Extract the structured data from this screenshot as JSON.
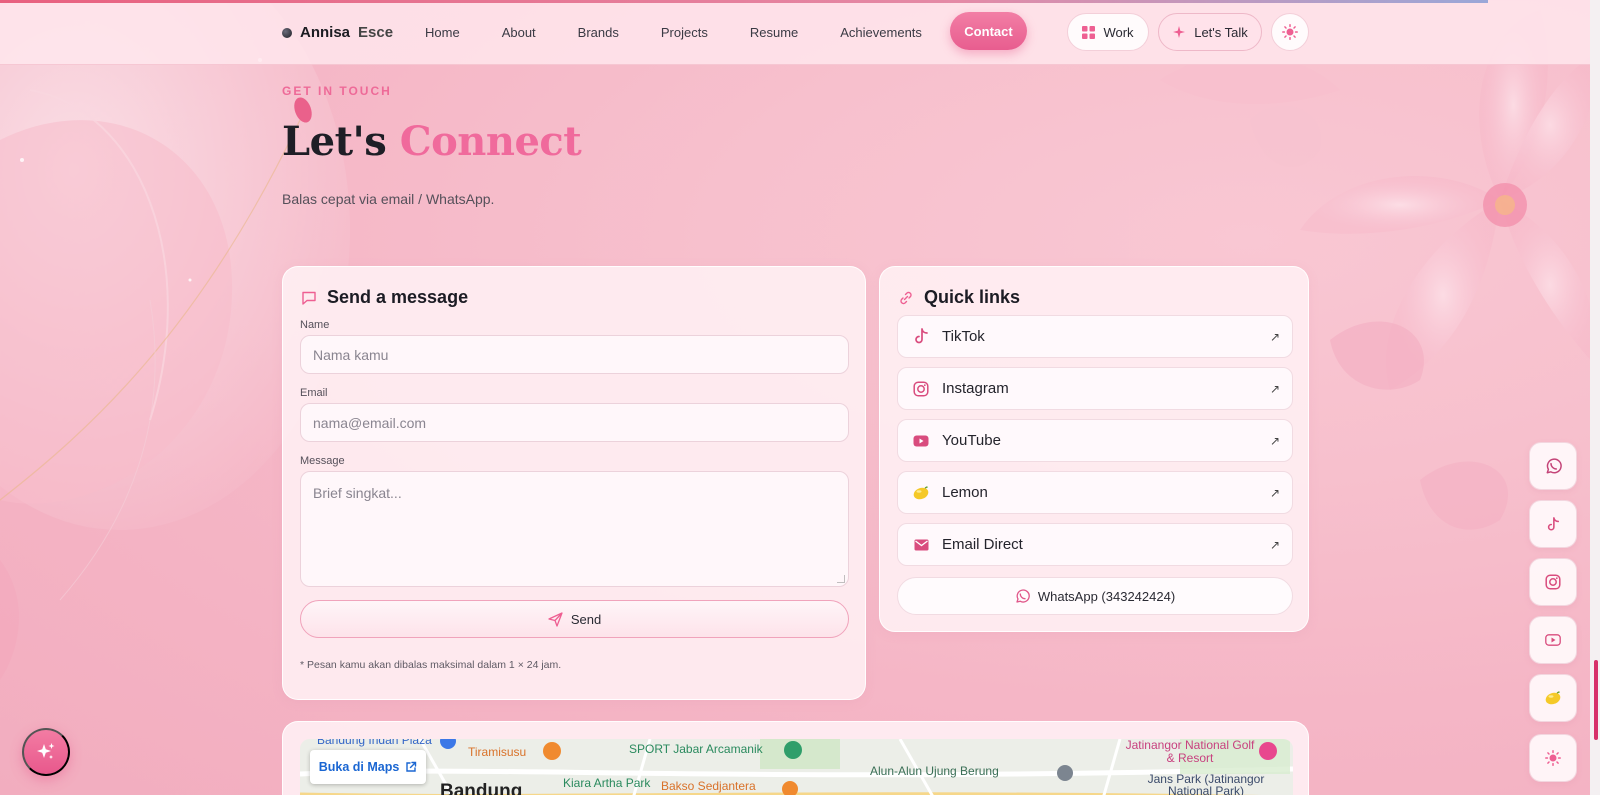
{
  "nav": {
    "brand_first": "Annisa",
    "brand_last": "Esce",
    "links": [
      "Home",
      "About",
      "Brands",
      "Projects",
      "Resume",
      "Achievements"
    ],
    "contact_label": "Contact",
    "work_label": "Work",
    "talk_label": "Let's Talk"
  },
  "hero": {
    "eyebrow": "GET IN TOUCH",
    "title_a": "Let's",
    "title_b": "Connect",
    "subtitle": "Balas cepat via email / WhatsApp."
  },
  "form": {
    "heading": "Send a message",
    "name_label": "Name",
    "name_placeholder": "Nama kamu",
    "email_label": "Email",
    "email_placeholder": "nama@email.com",
    "message_label": "Message",
    "message_placeholder": "Brief singkat...",
    "send_label": "Send",
    "note": "* Pesan kamu akan dibalas maksimal dalam 1 × 24 jam."
  },
  "quick_links": {
    "heading": "Quick links",
    "items": [
      {
        "label": "TikTok",
        "icon": "tiktok-icon"
      },
      {
        "label": "Instagram",
        "icon": "instagram-icon"
      },
      {
        "label": "YouTube",
        "icon": "youtube-icon"
      },
      {
        "label": "Lemon",
        "icon": "lemon-icon"
      },
      {
        "label": "Email Direct",
        "icon": "mail-icon"
      }
    ],
    "arrow": "↗",
    "whatsapp_label": "WhatsApp (343242424)"
  },
  "map": {
    "open_label": "Buka di Maps",
    "places": {
      "p1": "Bandung Indah Plaza",
      "p2": "Tiramisusu",
      "p3": "SPORT Jabar Arcamanik",
      "p4": "Alun-Alun Ujung Berung",
      "p5": "Jatinangor National Golf & Resort",
      "p6": "Bandung",
      "p7": "Kiara Artha Park",
      "p8": "Bakso Sedjantera",
      "p9": "Jans Park (Jatinangor National Park)"
    }
  },
  "colors": {
    "accent": "#f06a9c",
    "accent_dark": "#e85d8f",
    "map_link": "#1a66d2"
  }
}
